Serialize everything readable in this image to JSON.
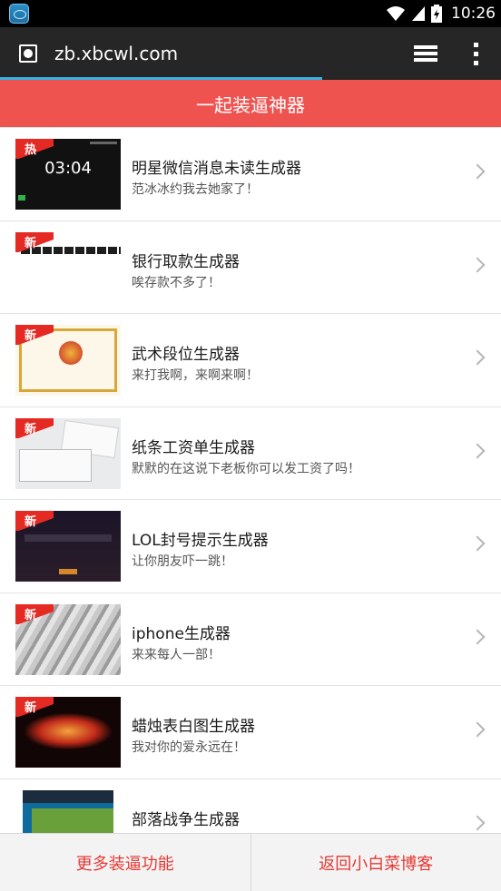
{
  "status_bar": {
    "time": "10:26",
    "icons": [
      "app-notification-icon",
      "wifi-icon",
      "signal-icon",
      "battery-icon"
    ]
  },
  "browser": {
    "url": "zb.xbcwl.com",
    "icons": [
      "site-icon",
      "tabs-icon",
      "overflow-menu-icon"
    ]
  },
  "header": {
    "title": "一起装逼神器"
  },
  "items": [
    {
      "title": "明星微信消息未读生成器",
      "subtitle": "范冰冰约我去她家了！",
      "badge": "热",
      "thumb": "phone",
      "thumb_time": "03:04"
    },
    {
      "title": "银行取款生成器",
      "subtitle": "唉存款不多了！",
      "badge": "新",
      "thumb": "bank"
    },
    {
      "title": "武术段位生成器",
      "subtitle": "来打我啊，来啊来啊！",
      "badge": "新",
      "thumb": "cert"
    },
    {
      "title": "纸条工资单生成器",
      "subtitle": "默默的在这说下老板你可以发工资了吗！",
      "badge": "新",
      "thumb": "paper"
    },
    {
      "title": "LOL封号提示生成器",
      "subtitle": "让你朋友吓一跳！",
      "badge": "新",
      "thumb": "lol"
    },
    {
      "title": "iphone生成器",
      "subtitle": "来来每人一部！",
      "badge": "新",
      "thumb": "iphone"
    },
    {
      "title": "蜡烛表白图生成器",
      "subtitle": "我对你的爱永远在！",
      "badge": "新",
      "thumb": "candle"
    },
    {
      "title": "部落战争生成器",
      "subtitle": "",
      "badge": "",
      "thumb": "coc"
    }
  ],
  "bottom_bar": {
    "left_label": "更多装逼功能",
    "right_label": "返回小白菜博客"
  },
  "colors": {
    "header_red": "#ef5350",
    "badge_red": "#e52a24",
    "bottom_text_red": "#e53935",
    "progress_blue": "#33b5e5"
  }
}
